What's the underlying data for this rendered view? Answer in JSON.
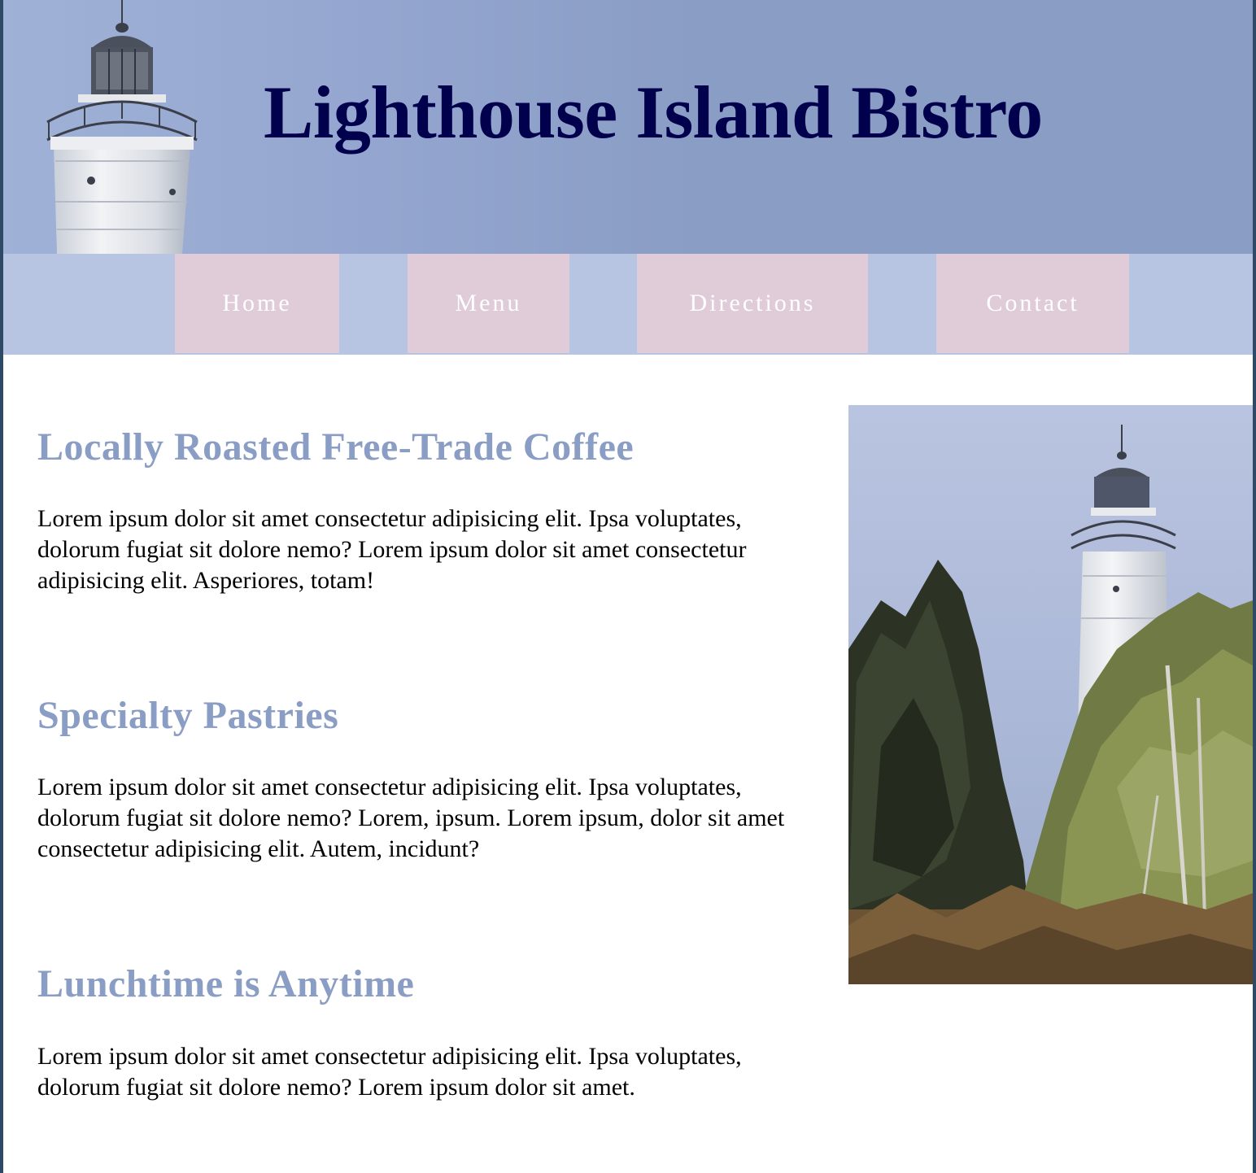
{
  "header": {
    "title": "Lighthouse Island Bistro"
  },
  "nav": {
    "items": [
      {
        "label": "Home"
      },
      {
        "label": "Menu"
      },
      {
        "label": "Directions"
      },
      {
        "label": "Contact"
      }
    ]
  },
  "main": {
    "sections": [
      {
        "heading": "Locally Roasted Free-Trade Coffee",
        "text": "Lorem ipsum dolor sit amet consectetur adipisicing elit. Ipsa voluptates, dolorum fugiat sit dolore nemo? Lorem ipsum dolor sit amet consectetur adipisicing elit. Asperiores, totam!"
      },
      {
        "heading": "Specialty Pastries",
        "text": "Lorem ipsum dolor sit amet consectetur adipisicing elit. Ipsa voluptates, dolorum fugiat sit dolore nemo? Lorem, ipsum. Lorem ipsum, dolor sit amet consectetur adipisicing elit. Autem, incidunt?"
      },
      {
        "heading": "Lunchtime is Anytime",
        "text": "Lorem ipsum dolor sit amet consectetur adipisicing elit. Ipsa voluptates, dolorum fugiat sit dolore nemo? Lorem ipsum dolor sit amet."
      }
    ]
  },
  "colors": {
    "header_bg": "#8a9dc5",
    "title": "#00004d",
    "nav_bg": "#b7c5e3",
    "nav_item_bg": "#e0cbd9",
    "heading": "#8a9dc5"
  }
}
